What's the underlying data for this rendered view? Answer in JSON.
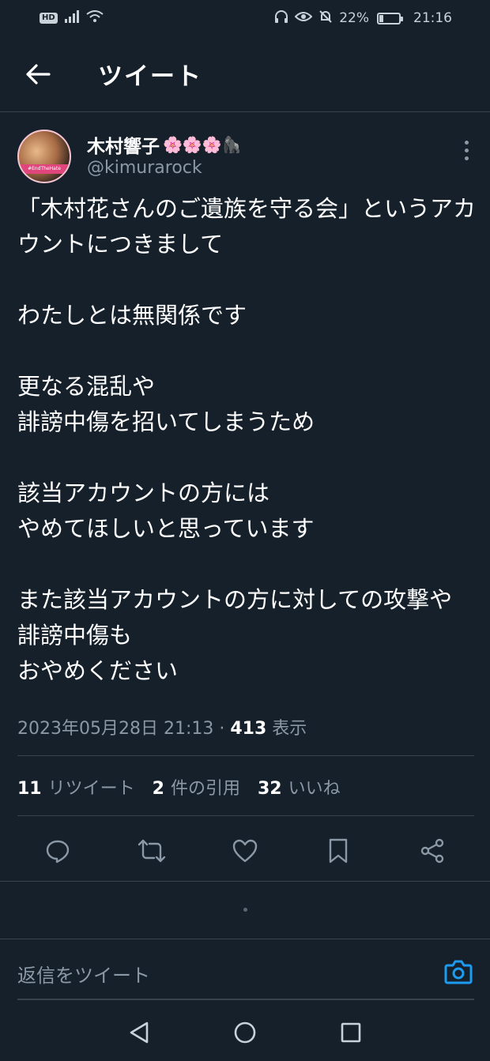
{
  "status_bar": {
    "hd_badge": "HD",
    "battery_text": "22%",
    "battery_level": 0.22,
    "time": "21:16"
  },
  "header": {
    "title": "ツイート"
  },
  "tweet": {
    "author": {
      "display_name": "木村響子",
      "emojis": "🌸🌸🌸🦍",
      "handle": "@kimurarock",
      "avatar_caption": "#EndTheHate"
    },
    "text": "「木村花さんのご遺族を守る会」というアカウントにつきまして\n\nわたしとは無関係です\n\n更なる混乱や\n誹謗中傷を招いてしまうため\n\n該当アカウントの方には\nやめてほしいと思っています\n\nまた該当アカウントの方に対しての攻撃や　誹謗中傷も\nおやめください",
    "timestamp": "2023年05月28日 21:13",
    "separator": " · ",
    "views_count": "413",
    "views_label": " 表示"
  },
  "stats": {
    "retweets_count": "11",
    "retweets_label": "リツイート",
    "quotes_count": "2",
    "quotes_label": "件の引用",
    "likes_count": "32",
    "likes_label": "いいね"
  },
  "reply": {
    "placeholder": "返信をツイート"
  },
  "colors": {
    "background": "#15202b",
    "muted": "#8b98a5",
    "divider": "#38444d",
    "accent": "#1d9bf0"
  },
  "icons": {
    "back": "arrow-left-icon",
    "more": "more-vertical-icon",
    "reply": "comment-icon",
    "retweet": "retweet-icon",
    "like": "heart-icon",
    "bookmark": "bookmark-icon",
    "share": "share-icon",
    "camera": "camera-icon"
  }
}
